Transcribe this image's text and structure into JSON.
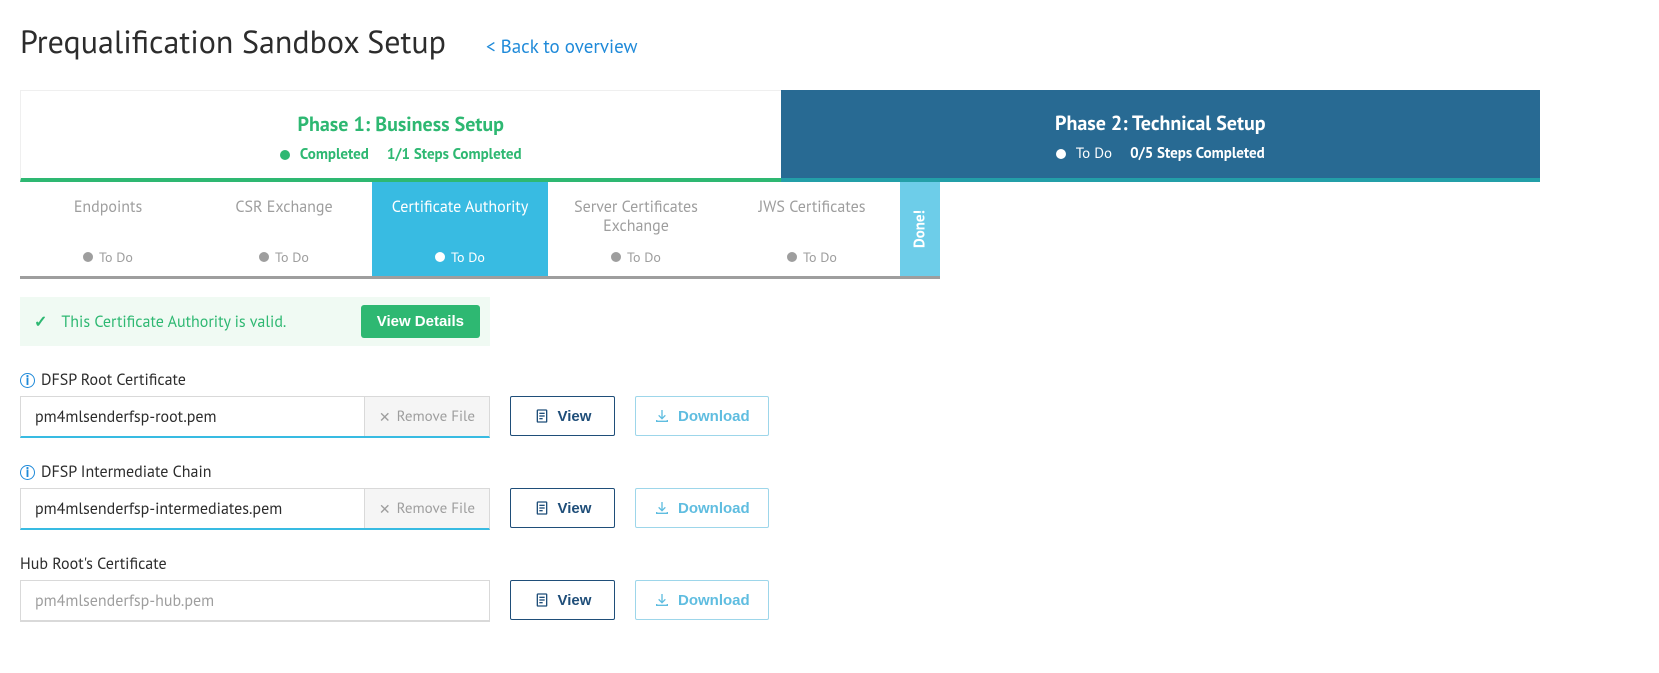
{
  "header": {
    "title": "Prequalification Sandbox Setup",
    "back_link": "< Back to overview"
  },
  "phases": {
    "phase1": {
      "title": "Phase 1: Business Setup",
      "status": "Completed",
      "steps": "1/1 Steps Completed"
    },
    "phase2": {
      "title": "Phase 2: Technical Setup",
      "status": "To Do",
      "steps": "0/5 Steps Completed"
    }
  },
  "step_tabs": {
    "endpoints": {
      "label": "Endpoints",
      "status": "To Do"
    },
    "csr": {
      "label": "CSR Exchange",
      "status": "To Do"
    },
    "ca": {
      "label": "Certificate Authority",
      "status": "To Do"
    },
    "server_certs": {
      "label": "Server Certificates Exchange",
      "status": "To Do"
    },
    "jws": {
      "label": "JWS Certificates",
      "status": "To Do"
    },
    "done": "Done!"
  },
  "banner": {
    "text": "This Certificate Authority is valid.",
    "button": "View Details"
  },
  "labels": {
    "remove": "Remove File",
    "view": "View",
    "download": "Download"
  },
  "certs": {
    "root": {
      "label": "DFSP Root Certificate",
      "file": "pm4mlsenderfsp-root.pem"
    },
    "intermediate": {
      "label": "DFSP Intermediate Chain",
      "file": "pm4mlsenderfsp-intermediates.pem"
    },
    "hub": {
      "label": "Hub Root's Certificate",
      "file": "pm4mlsenderfsp-hub.pem"
    }
  }
}
